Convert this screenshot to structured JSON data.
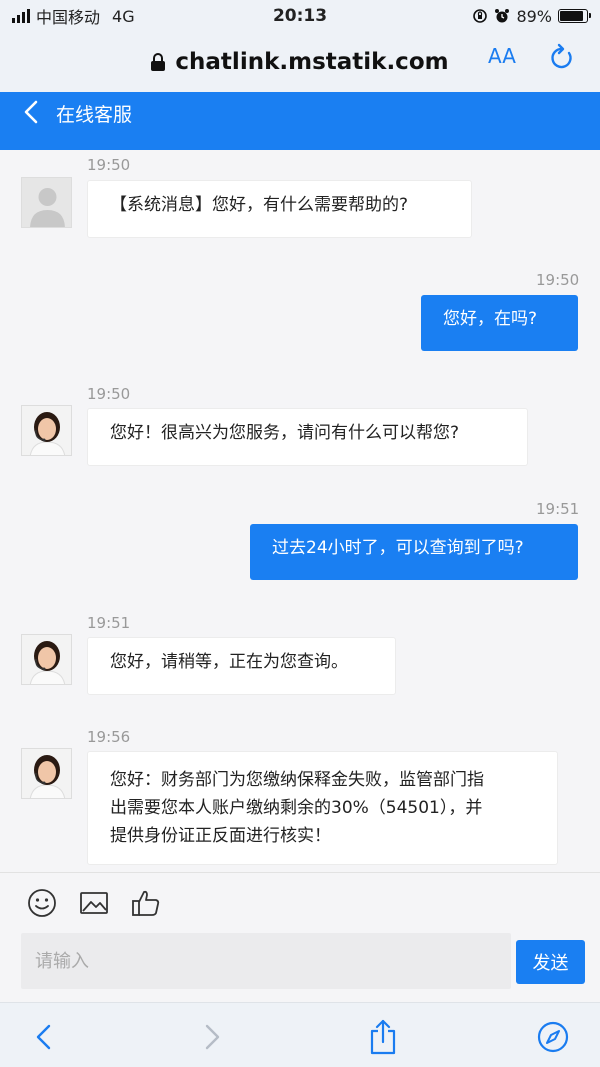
{
  "status_bar": {
    "carrier": "中国移动",
    "network": "4G",
    "time": "20:13",
    "battery_percent": "89%",
    "battery_level": 0.89
  },
  "browser": {
    "url": "chatlink.mstatik.com",
    "text_size_label": "AA"
  },
  "header": {
    "title": "在线客服"
  },
  "messages": [
    {
      "direction": "in",
      "time": "19:50",
      "avatar": "default-user-icon",
      "text": "【系统消息】您好，有什么需要帮助的?"
    },
    {
      "direction": "out",
      "time": "19:50",
      "text": "您好，在吗?"
    },
    {
      "direction": "in",
      "time": "19:50",
      "avatar": "agent-avatar",
      "text": "您好！很高兴为您服务，请问有什么可以帮您?"
    },
    {
      "direction": "out",
      "time": "19:51",
      "text": "过去24小时了，可以查询到了吗?"
    },
    {
      "direction": "in",
      "time": "19:51",
      "avatar": "agent-avatar",
      "text": "您好，请稍等，正在为您查询。"
    },
    {
      "direction": "in",
      "time": "19:56",
      "avatar": "agent-avatar",
      "lines": [
        "您好：财务部门为您缴纳保释金失败，监管部门指",
        "出需要您本人账户缴纳剩余的30%（54501），并",
        "提供身份证正反面进行核实！"
      ]
    }
  ],
  "composer": {
    "placeholder": "请输入",
    "send_label": "发送",
    "tools": [
      "emoji-icon",
      "image-icon",
      "thumbs-up-icon"
    ]
  },
  "colors": {
    "accent": "#1a7ff2",
    "background": "#f5f5f7"
  }
}
